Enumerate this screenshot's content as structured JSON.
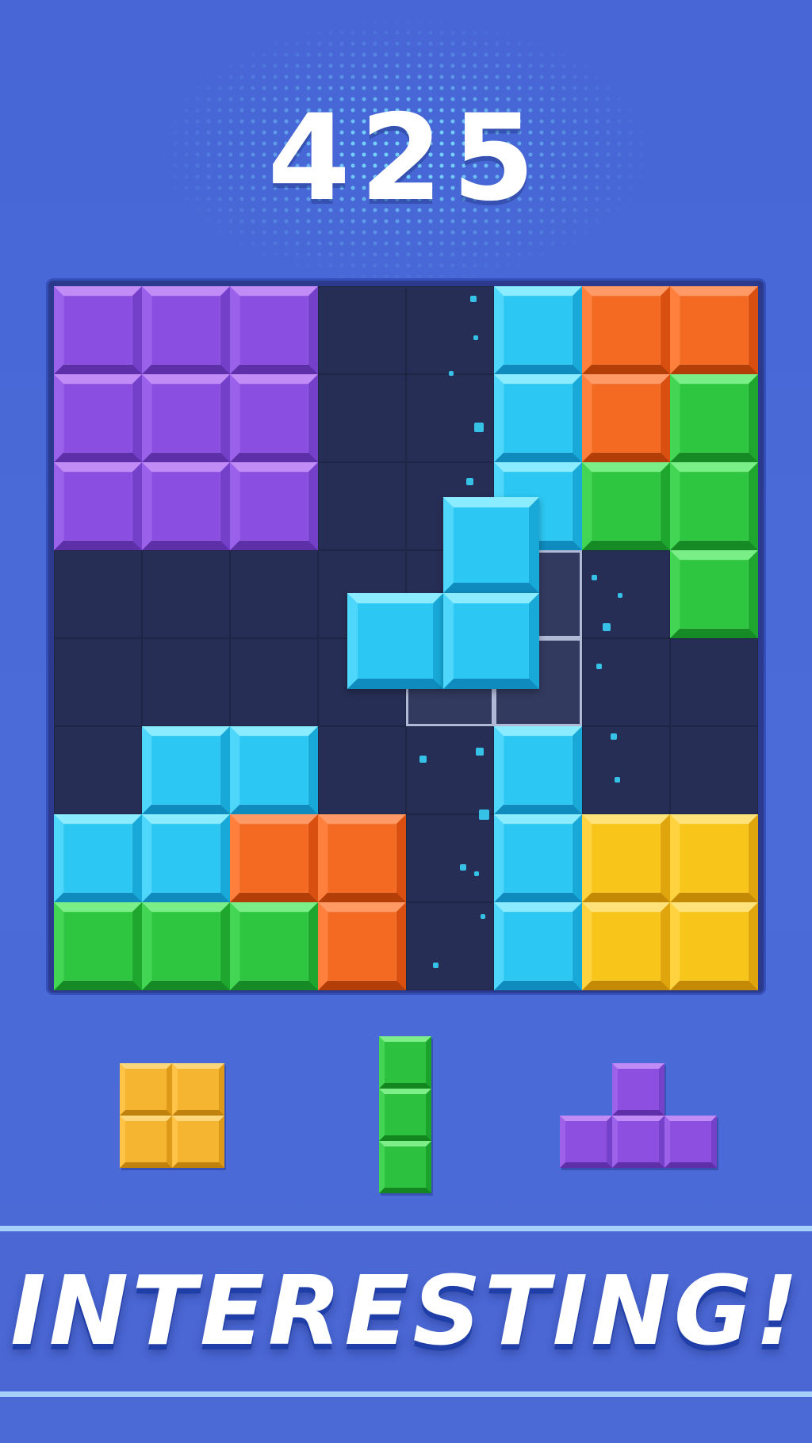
{
  "score": "425",
  "board": {
    "rows": 8,
    "cols": 8,
    "cells": [
      [
        "purple",
        "purple",
        "purple",
        "",
        "",
        "cyan",
        "orange",
        "orange"
      ],
      [
        "purple",
        "purple",
        "purple",
        "",
        "",
        "cyan",
        "orange",
        "green"
      ],
      [
        "purple",
        "purple",
        "purple",
        "",
        "",
        "cyan",
        "green",
        "green"
      ],
      [
        "",
        "",
        "",
        "",
        "",
        "",
        "",
        "green"
      ],
      [
        "",
        "",
        "",
        "",
        "",
        "",
        "",
        ""
      ],
      [
        "",
        "cyan",
        "cyan",
        "",
        "",
        "cyan",
        "",
        ""
      ],
      [
        "cyan",
        "cyan",
        "orange",
        "orange",
        "",
        "cyan",
        "yellow",
        "yellow"
      ],
      [
        "green",
        "green",
        "green",
        "orange",
        "",
        "cyan",
        "yellow",
        "yellow"
      ]
    ],
    "ghost_cells": [
      [
        3,
        5
      ],
      [
        4,
        4
      ],
      [
        4,
        5
      ]
    ]
  },
  "dragging_piece": {
    "color": "cyan",
    "shape": [
      [
        0,
        1
      ],
      [
        1,
        0
      ],
      [
        1,
        1
      ]
    ]
  },
  "tray": [
    {
      "color": "yellow",
      "shape": [
        [
          0,
          0
        ],
        [
          0,
          1
        ],
        [
          1,
          0
        ],
        [
          1,
          1
        ]
      ]
    },
    {
      "color": "green",
      "shape": [
        [
          0,
          0
        ],
        [
          1,
          0
        ],
        [
          2,
          0
        ]
      ]
    },
    {
      "color": "purple",
      "shape": [
        [
          0,
          1
        ],
        [
          1,
          0
        ],
        [
          1,
          1
        ],
        [
          1,
          2
        ]
      ]
    }
  ],
  "banner_text": "INTERESTING!"
}
